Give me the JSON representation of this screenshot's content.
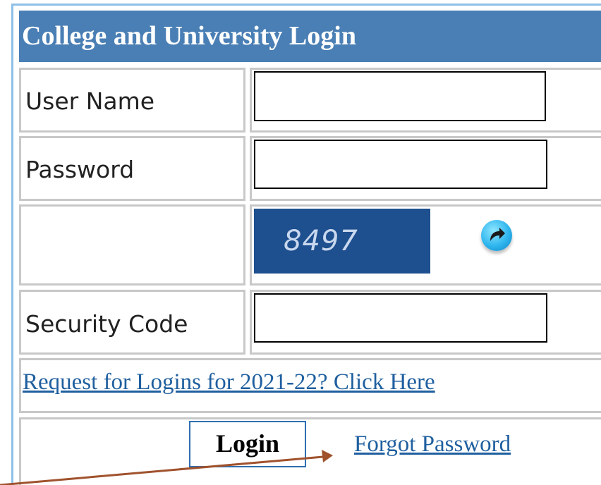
{
  "form": {
    "title": "College and University Login",
    "username_label": "User Name",
    "username_value": "",
    "password_label": "Password",
    "password_value": "",
    "captcha_code": "8497",
    "security_code_label": "Security Code",
    "security_code_value": "",
    "request_link": "Request for Logins for 2021-22? Click Here",
    "login_button": "Login",
    "forgot_password_link": "Forgot Password"
  },
  "icons": {
    "refresh": "refresh-icon",
    "annotation": "arrow-annotation"
  },
  "colors": {
    "header_bg": "#4a7fb5",
    "captcha_bg": "#1e4f8e",
    "link": "#1f5f9f",
    "arrow": "#a0522d",
    "cell_border": "#c8c8c8",
    "outer_border": "#8ec0e8"
  }
}
